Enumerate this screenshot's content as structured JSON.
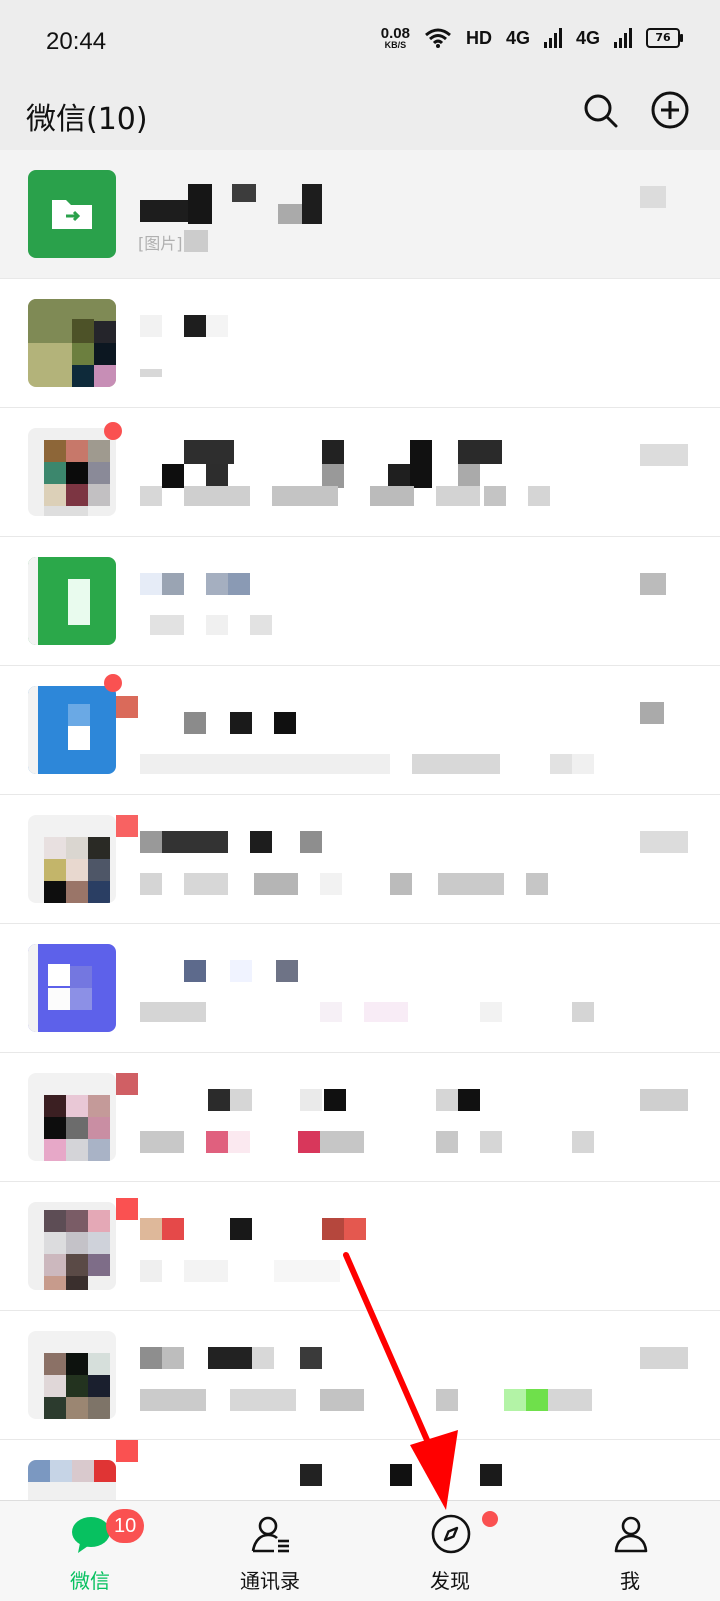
{
  "status": {
    "time": "20:44",
    "net_speed": "0.08",
    "net_unit": "KB/S",
    "hd": "HD",
    "sig1": "4G",
    "sig2": "4G",
    "battery": "76"
  },
  "header": {
    "title": "微信(10)"
  },
  "chats": [
    {
      "pinned": true,
      "preview": "[图片]"
    },
    {},
    {},
    {},
    {},
    {},
    {},
    {},
    {},
    {},
    {}
  ],
  "tabs": [
    {
      "label": "微信",
      "badge": "10",
      "icon": "chat-bubble-icon"
    },
    {
      "label": "通讯录",
      "icon": "contacts-icon"
    },
    {
      "label": "发现",
      "icon": "compass-icon"
    },
    {
      "label": "我",
      "icon": "person-icon"
    }
  ],
  "colors": {
    "accent": "#07c160",
    "badge": "#fa5151",
    "annotation": "#ff0000"
  }
}
